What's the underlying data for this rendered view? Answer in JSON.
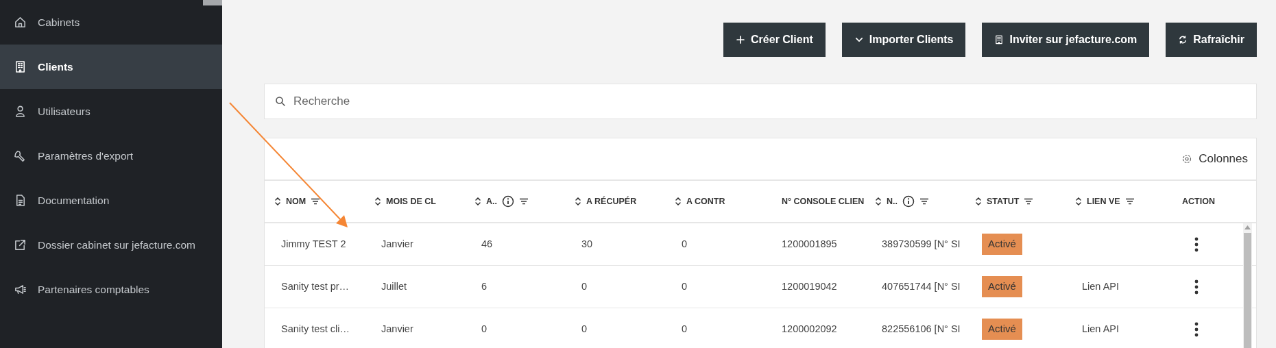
{
  "sidebar": {
    "items": [
      {
        "label": "Cabinets",
        "kind": "home",
        "selected": false
      },
      {
        "label": "Clients",
        "kind": "building",
        "selected": true
      },
      {
        "label": "Utilisateurs",
        "kind": "user",
        "selected": false
      },
      {
        "label": "Paramètres d'export",
        "kind": "wrench",
        "selected": false
      },
      {
        "label": "Documentation",
        "kind": "document",
        "selected": false
      },
      {
        "label": "Dossier cabinet sur jefacture.com",
        "kind": "external",
        "selected": false
      },
      {
        "label": "Partenaires comptables",
        "kind": "megaphone",
        "selected": false
      }
    ]
  },
  "toolbar": {
    "buttons": [
      {
        "label": "Créer Client",
        "kind": "plus"
      },
      {
        "label": "Importer Clients",
        "kind": "caret"
      },
      {
        "label": "Inviter sur jefacture.com",
        "kind": "building"
      },
      {
        "label": "Rafraîchir",
        "kind": "refresh"
      }
    ]
  },
  "search": {
    "placeholder": "Recherche"
  },
  "table": {
    "columns_button": "Colonnes",
    "columns": [
      {
        "label": "NOM",
        "kind": "text",
        "sort": true,
        "info": false,
        "filter": true
      },
      {
        "label": "MOIS DE CL",
        "kind": "text",
        "sort": true,
        "info": false,
        "filter": false
      },
      {
        "label": "A..",
        "kind": "text",
        "sort": true,
        "info": true,
        "filter": true
      },
      {
        "label": "A RÉCUPÉR",
        "kind": "text",
        "sort": true,
        "info": false,
        "filter": false
      },
      {
        "label": "A CONTR",
        "kind": "text",
        "sort": true,
        "info": false,
        "filter": false
      },
      {
        "label": "N° CONSOLE CLIEN",
        "kind": "text",
        "sort": false,
        "info": false,
        "filter": false
      },
      {
        "label": "N..",
        "kind": "text",
        "sort": true,
        "info": true,
        "filter": true
      },
      {
        "label": "STATUT",
        "kind": "badge",
        "sort": true,
        "info": false,
        "filter": true
      },
      {
        "label": "LIEN VE",
        "kind": "text",
        "sort": true,
        "info": false,
        "filter": true
      },
      {
        "label": "ACTION",
        "kind": "action",
        "sort": false,
        "info": false,
        "filter": false
      }
    ],
    "rows": [
      {
        "cells": [
          "Jimmy TEST 2",
          "Janvier",
          "46",
          "30",
          "0",
          "1200001895",
          "389730599 [N° SI",
          "Activé",
          null
        ]
      },
      {
        "cells": [
          "Sanity test pr…",
          "Juillet",
          "6",
          "0",
          "0",
          "1200019042",
          "407651744 [N° SI",
          "Activé",
          "Lien API"
        ]
      },
      {
        "cells": [
          "Sanity test cli…",
          "Janvier",
          "0",
          "0",
          "0",
          "1200002092",
          "822556106 [N° SI",
          "Activé",
          "Lien API"
        ]
      }
    ]
  }
}
